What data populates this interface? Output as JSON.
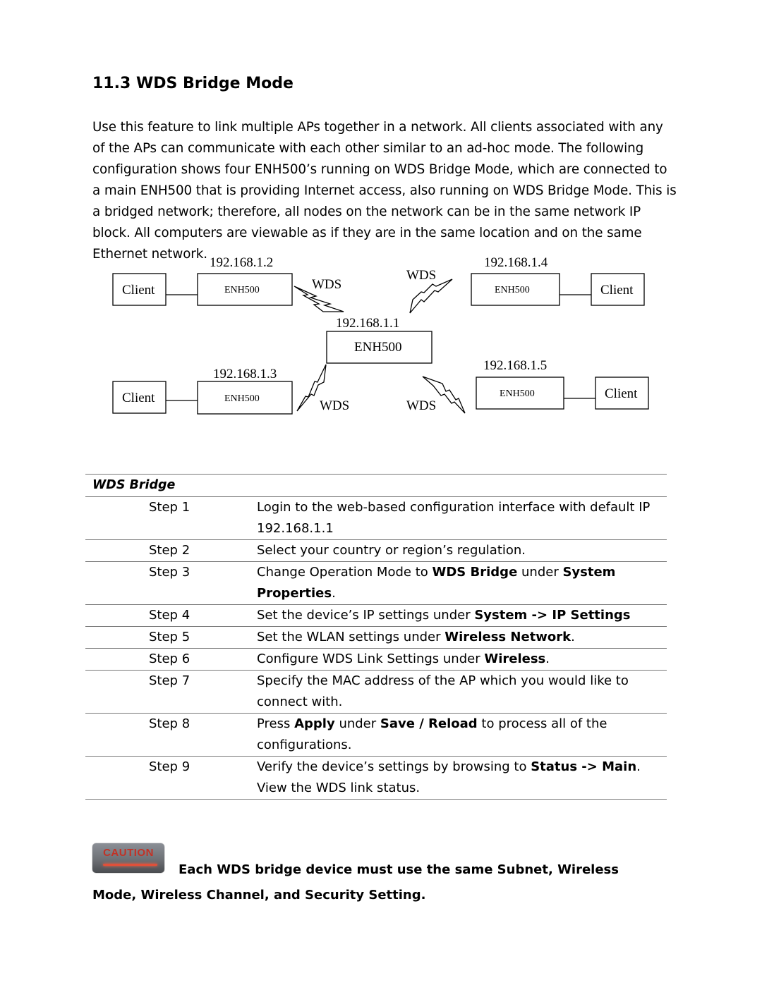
{
  "heading": "11.3 WDS Bridge Mode",
  "intro": "Use this feature to link multiple APs together in a network. All clients associated with any of the APs can communicate with each other similar to an ad-hoc mode.   The following configuration shows four ENH500’s running on WDS Bridge Mode, which are connected to a main ENH500 that is providing Internet access, also running on WDS Bridge Mode. This is a bridged network; therefore, all nodes on the network can be in the same network IP block. All computers are viewable as if they are in the same location and on the same Ethernet network.",
  "diagram": {
    "main": {
      "ip": "192.168.1.1",
      "label": "ENH500"
    },
    "nodes": [
      {
        "ip": "192.168.1.2",
        "label": "ENH500",
        "client": "Client",
        "link": "WDS"
      },
      {
        "ip": "192.168.1.4",
        "label": "ENH500",
        "client": "Client",
        "link": "WDS"
      },
      {
        "ip": "192.168.1.3",
        "label": "ENH500",
        "client": "Client",
        "link": "WDS"
      },
      {
        "ip": "192.168.1.5",
        "label": "ENH500",
        "client": "Client",
        "link": "WDS"
      }
    ]
  },
  "table": {
    "title": "WDS Bridge",
    "rows": [
      {
        "step": "Step 1",
        "parts": [
          {
            "t": "Login to the web-based configuration interface with default IP 192.168.1.1"
          }
        ]
      },
      {
        "step": "Step 2",
        "parts": [
          {
            "t": "Select your country or region’s regulation."
          }
        ]
      },
      {
        "step": "Step 3",
        "parts": [
          {
            "t": "Change Operation Mode to "
          },
          {
            "t": "WDS Bridge",
            "b": true
          },
          {
            "t": " under "
          },
          {
            "t": "System Properties",
            "b": true
          },
          {
            "t": "."
          }
        ]
      },
      {
        "step": "Step 4",
        "parts": [
          {
            "t": "Set the device’s IP settings under "
          },
          {
            "t": "System -> IP Settings",
            "b": true
          }
        ]
      },
      {
        "step": "Step 5",
        "parts": [
          {
            "t": "Set the WLAN settings under "
          },
          {
            "t": "Wireless Network",
            "b": true
          },
          {
            "t": "."
          }
        ]
      },
      {
        "step": "Step 6",
        "parts": [
          {
            "t": "Configure WDS Link Settings under "
          },
          {
            "t": "Wireless",
            "b": true
          },
          {
            "t": "."
          }
        ]
      },
      {
        "step": "Step 7",
        "parts": [
          {
            "t": "Specify the MAC address of the AP which you would like to connect with."
          }
        ]
      },
      {
        "step": "Step 8",
        "parts": [
          {
            "t": "Press "
          },
          {
            "t": "Apply",
            "b": true
          },
          {
            "t": " under "
          },
          {
            "t": "Save / Reload",
            "b": true
          },
          {
            "t": " to process all of the configurations."
          }
        ]
      },
      {
        "step": "Step 9",
        "parts": [
          {
            "t": "Verify the device’s settings by browsing to "
          },
          {
            "t": "Status -> Main",
            "b": true
          },
          {
            "t": ". View the WDS link status."
          }
        ]
      }
    ]
  },
  "caution": {
    "badge": "CAUTION",
    "text": "Each WDS bridge device must use the same Subnet, Wireless Mode, Wireless Channel, and Security Setting."
  }
}
